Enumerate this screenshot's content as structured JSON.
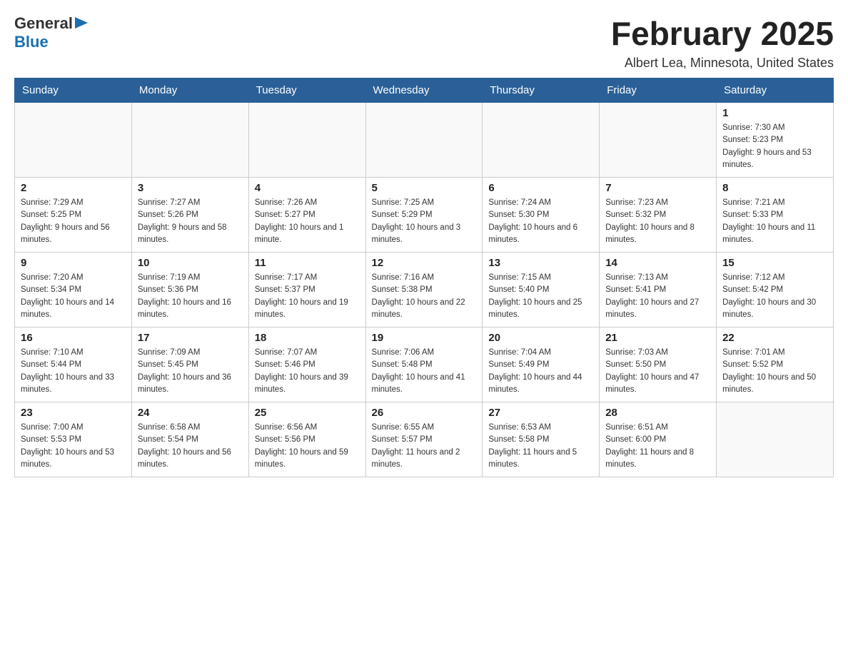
{
  "header": {
    "logo": {
      "general": "General",
      "arrow_char": "▶",
      "blue": "Blue"
    },
    "title": "February 2025",
    "location": "Albert Lea, Minnesota, United States"
  },
  "weekdays": [
    "Sunday",
    "Monday",
    "Tuesday",
    "Wednesday",
    "Thursday",
    "Friday",
    "Saturday"
  ],
  "weeks": [
    [
      {
        "day": "",
        "info": ""
      },
      {
        "day": "",
        "info": ""
      },
      {
        "day": "",
        "info": ""
      },
      {
        "day": "",
        "info": ""
      },
      {
        "day": "",
        "info": ""
      },
      {
        "day": "",
        "info": ""
      },
      {
        "day": "1",
        "info": "Sunrise: 7:30 AM\nSunset: 5:23 PM\nDaylight: 9 hours and 53 minutes."
      }
    ],
    [
      {
        "day": "2",
        "info": "Sunrise: 7:29 AM\nSunset: 5:25 PM\nDaylight: 9 hours and 56 minutes."
      },
      {
        "day": "3",
        "info": "Sunrise: 7:27 AM\nSunset: 5:26 PM\nDaylight: 9 hours and 58 minutes."
      },
      {
        "day": "4",
        "info": "Sunrise: 7:26 AM\nSunset: 5:27 PM\nDaylight: 10 hours and 1 minute."
      },
      {
        "day": "5",
        "info": "Sunrise: 7:25 AM\nSunset: 5:29 PM\nDaylight: 10 hours and 3 minutes."
      },
      {
        "day": "6",
        "info": "Sunrise: 7:24 AM\nSunset: 5:30 PM\nDaylight: 10 hours and 6 minutes."
      },
      {
        "day": "7",
        "info": "Sunrise: 7:23 AM\nSunset: 5:32 PM\nDaylight: 10 hours and 8 minutes."
      },
      {
        "day": "8",
        "info": "Sunrise: 7:21 AM\nSunset: 5:33 PM\nDaylight: 10 hours and 11 minutes."
      }
    ],
    [
      {
        "day": "9",
        "info": "Sunrise: 7:20 AM\nSunset: 5:34 PM\nDaylight: 10 hours and 14 minutes."
      },
      {
        "day": "10",
        "info": "Sunrise: 7:19 AM\nSunset: 5:36 PM\nDaylight: 10 hours and 16 minutes."
      },
      {
        "day": "11",
        "info": "Sunrise: 7:17 AM\nSunset: 5:37 PM\nDaylight: 10 hours and 19 minutes."
      },
      {
        "day": "12",
        "info": "Sunrise: 7:16 AM\nSunset: 5:38 PM\nDaylight: 10 hours and 22 minutes."
      },
      {
        "day": "13",
        "info": "Sunrise: 7:15 AM\nSunset: 5:40 PM\nDaylight: 10 hours and 25 minutes."
      },
      {
        "day": "14",
        "info": "Sunrise: 7:13 AM\nSunset: 5:41 PM\nDaylight: 10 hours and 27 minutes."
      },
      {
        "day": "15",
        "info": "Sunrise: 7:12 AM\nSunset: 5:42 PM\nDaylight: 10 hours and 30 minutes."
      }
    ],
    [
      {
        "day": "16",
        "info": "Sunrise: 7:10 AM\nSunset: 5:44 PM\nDaylight: 10 hours and 33 minutes."
      },
      {
        "day": "17",
        "info": "Sunrise: 7:09 AM\nSunset: 5:45 PM\nDaylight: 10 hours and 36 minutes."
      },
      {
        "day": "18",
        "info": "Sunrise: 7:07 AM\nSunset: 5:46 PM\nDaylight: 10 hours and 39 minutes."
      },
      {
        "day": "19",
        "info": "Sunrise: 7:06 AM\nSunset: 5:48 PM\nDaylight: 10 hours and 41 minutes."
      },
      {
        "day": "20",
        "info": "Sunrise: 7:04 AM\nSunset: 5:49 PM\nDaylight: 10 hours and 44 minutes."
      },
      {
        "day": "21",
        "info": "Sunrise: 7:03 AM\nSunset: 5:50 PM\nDaylight: 10 hours and 47 minutes."
      },
      {
        "day": "22",
        "info": "Sunrise: 7:01 AM\nSunset: 5:52 PM\nDaylight: 10 hours and 50 minutes."
      }
    ],
    [
      {
        "day": "23",
        "info": "Sunrise: 7:00 AM\nSunset: 5:53 PM\nDaylight: 10 hours and 53 minutes."
      },
      {
        "day": "24",
        "info": "Sunrise: 6:58 AM\nSunset: 5:54 PM\nDaylight: 10 hours and 56 minutes."
      },
      {
        "day": "25",
        "info": "Sunrise: 6:56 AM\nSunset: 5:56 PM\nDaylight: 10 hours and 59 minutes."
      },
      {
        "day": "26",
        "info": "Sunrise: 6:55 AM\nSunset: 5:57 PM\nDaylight: 11 hours and 2 minutes."
      },
      {
        "day": "27",
        "info": "Sunrise: 6:53 AM\nSunset: 5:58 PM\nDaylight: 11 hours and 5 minutes."
      },
      {
        "day": "28",
        "info": "Sunrise: 6:51 AM\nSunset: 6:00 PM\nDaylight: 11 hours and 8 minutes."
      },
      {
        "day": "",
        "info": ""
      }
    ]
  ]
}
